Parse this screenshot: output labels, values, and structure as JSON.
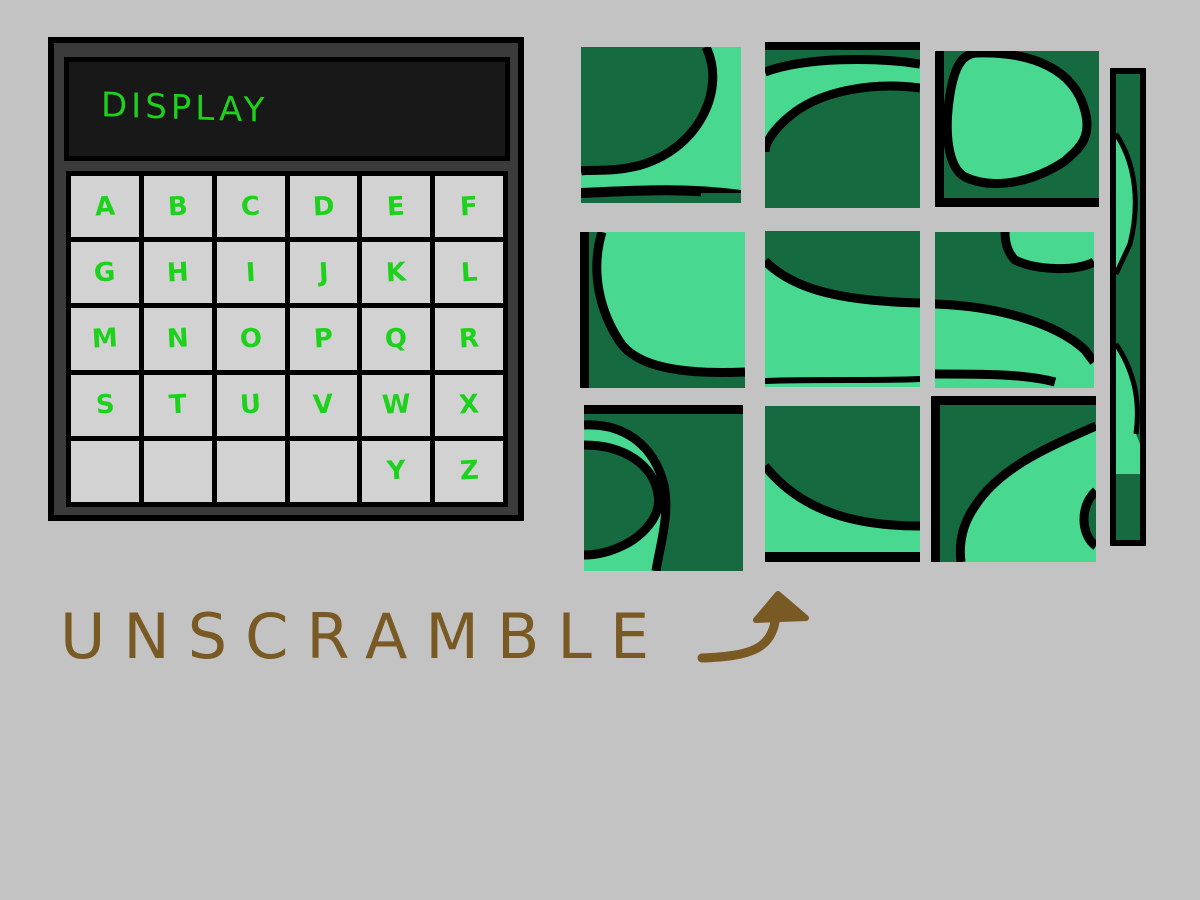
{
  "display": {
    "text": "DISPLAY"
  },
  "keypad": {
    "rows": [
      [
        "A",
        "B",
        "C",
        "D",
        "E",
        "F"
      ],
      [
        "G",
        "H",
        "I",
        "J",
        "K",
        "L"
      ],
      [
        "M",
        "N",
        "O",
        "P",
        "Q",
        "R"
      ],
      [
        "S",
        "T",
        "U",
        "V",
        "W",
        "X"
      ],
      [
        "",
        "",
        "",
        "",
        "Y",
        "Z"
      ]
    ]
  },
  "hint": {
    "text": "UNSCRAMBLE"
  },
  "colors": {
    "background": "#c3c3c3",
    "device": "#3b3b3b",
    "screen": "#181818",
    "key": "#d2d2d2",
    "key_text": "#1dd11d",
    "tile_dark": "#156a40",
    "tile_light": "#48d890",
    "hint_ink": "#7a5a24"
  },
  "icons": {
    "hint_arrow": "curved-arrow-up-icon"
  }
}
